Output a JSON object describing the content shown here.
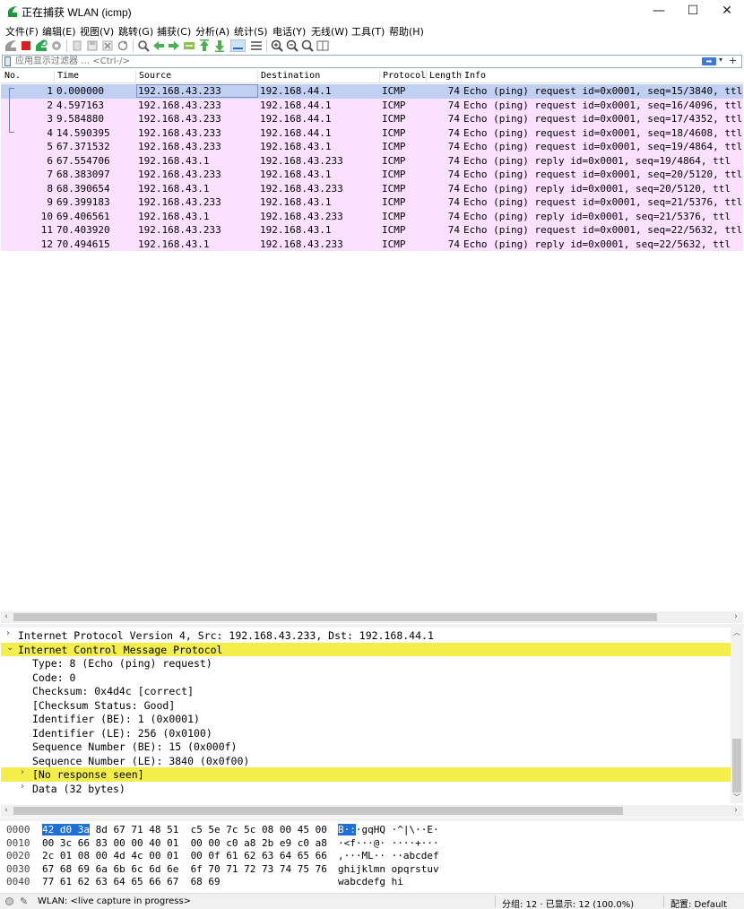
{
  "window": {
    "title": "正在捕获 WLAN (icmp)",
    "minimize_glyph": "—",
    "maximize_glyph": "☐",
    "close_glyph": "✕"
  },
  "menu": [
    "文件(F)",
    "编辑(E)",
    "视图(V)",
    "跳转(G)",
    "捕获(C)",
    "分析(A)",
    "统计(S)",
    "电话(Y)",
    "无线(W)",
    "工具(T)",
    "帮助(H)"
  ],
  "toolbar": {
    "icons": [
      "shark-fin-start-icon",
      "stop-capture-icon",
      "restart-capture-icon",
      "capture-options-icon",
      "open-file-icon",
      "save-file-icon",
      "close-file-icon",
      "reload-file-icon",
      "find-packet-icon",
      "go-back-icon",
      "go-forward-icon",
      "go-to-packet-icon",
      "go-first-icon",
      "go-last-icon",
      "auto-scroll-icon",
      "colorize-icon",
      "zoom-in-icon",
      "zoom-out-icon",
      "zoom-normal-icon",
      "resize-columns-icon"
    ]
  },
  "filter": {
    "placeholder": "应用显示过滤器 … <Ctrl-/>",
    "apply_glyph": "➡",
    "dropdown_glyph": "▾",
    "add_glyph": "+"
  },
  "packet_list": {
    "columns": [
      "No.",
      "Time",
      "Source",
      "Destination",
      "Protocol",
      "Length",
      "Info"
    ],
    "rows": [
      {
        "no": "1",
        "time": "0.000000",
        "src": "192.168.43.233",
        "dst": "192.168.44.1",
        "proto": "ICMP",
        "len": "74",
        "info": "Echo (ping) request  id=0x0001, seq=15/3840, ttl"
      },
      {
        "no": "2",
        "time": "4.597163",
        "src": "192.168.43.233",
        "dst": "192.168.44.1",
        "proto": "ICMP",
        "len": "74",
        "info": "Echo (ping) request  id=0x0001, seq=16/4096, ttl"
      },
      {
        "no": "3",
        "time": "9.584880",
        "src": "192.168.43.233",
        "dst": "192.168.44.1",
        "proto": "ICMP",
        "len": "74",
        "info": "Echo (ping) request  id=0x0001, seq=17/4352, ttl"
      },
      {
        "no": "4",
        "time": "14.590395",
        "src": "192.168.43.233",
        "dst": "192.168.44.1",
        "proto": "ICMP",
        "len": "74",
        "info": "Echo (ping) request  id=0x0001, seq=18/4608, ttl"
      },
      {
        "no": "5",
        "time": "67.371532",
        "src": "192.168.43.233",
        "dst": "192.168.43.1",
        "proto": "ICMP",
        "len": "74",
        "info": "Echo (ping) request  id=0x0001, seq=19/4864, ttl"
      },
      {
        "no": "6",
        "time": "67.554706",
        "src": "192.168.43.1",
        "dst": "192.168.43.233",
        "proto": "ICMP",
        "len": "74",
        "info": "Echo (ping) reply    id=0x0001, seq=19/4864, ttl"
      },
      {
        "no": "7",
        "time": "68.383097",
        "src": "192.168.43.233",
        "dst": "192.168.43.1",
        "proto": "ICMP",
        "len": "74",
        "info": "Echo (ping) request  id=0x0001, seq=20/5120, ttl"
      },
      {
        "no": "8",
        "time": "68.390654",
        "src": "192.168.43.1",
        "dst": "192.168.43.233",
        "proto": "ICMP",
        "len": "74",
        "info": "Echo (ping) reply    id=0x0001, seq=20/5120, ttl"
      },
      {
        "no": "9",
        "time": "69.399183",
        "src": "192.168.43.233",
        "dst": "192.168.43.1",
        "proto": "ICMP",
        "len": "74",
        "info": "Echo (ping) request  id=0x0001, seq=21/5376, ttl"
      },
      {
        "no": "10",
        "time": "69.406561",
        "src": "192.168.43.1",
        "dst": "192.168.43.233",
        "proto": "ICMP",
        "len": "74",
        "info": "Echo (ping) reply    id=0x0001, seq=21/5376, ttl"
      },
      {
        "no": "11",
        "time": "70.403920",
        "src": "192.168.43.233",
        "dst": "192.168.43.1",
        "proto": "ICMP",
        "len": "74",
        "info": "Echo (ping) request  id=0x0001, seq=22/5632, ttl"
      },
      {
        "no": "12",
        "time": "70.494615",
        "src": "192.168.43.1",
        "dst": "192.168.43.233",
        "proto": "ICMP",
        "len": "74",
        "info": "Echo (ping) reply    id=0x0001, seq=22/5632, ttl"
      }
    ],
    "selected_row": "1"
  },
  "details": [
    {
      "arrow": "›",
      "text": "Internet Protocol Version 4, Src: 192.168.43.233, Dst: 192.168.44.1",
      "level": 0,
      "hl": false
    },
    {
      "arrow": "⌄",
      "text": "Internet Control Message Protocol",
      "level": 0,
      "hl": true
    },
    {
      "arrow": "",
      "text": "Type: 8 (Echo (ping) request)",
      "level": 1,
      "hl": false
    },
    {
      "arrow": "",
      "text": "Code: 0",
      "level": 1,
      "hl": false
    },
    {
      "arrow": "",
      "text": "Checksum: 0x4d4c [correct]",
      "level": 1,
      "hl": false
    },
    {
      "arrow": "",
      "text": "[Checksum Status: Good]",
      "level": 1,
      "hl": false
    },
    {
      "arrow": "",
      "text": "Identifier (BE): 1 (0x0001)",
      "level": 1,
      "hl": false
    },
    {
      "arrow": "",
      "text": "Identifier (LE): 256 (0x0100)",
      "level": 1,
      "hl": false
    },
    {
      "arrow": "",
      "text": "Sequence Number (BE): 15 (0x000f)",
      "level": 1,
      "hl": false
    },
    {
      "arrow": "",
      "text": "Sequence Number (LE): 3840 (0x0f00)",
      "level": 1,
      "hl": false
    },
    {
      "arrow": "›",
      "text": "[No response seen]",
      "level": 1,
      "hl": true
    },
    {
      "arrow": "›",
      "text": "Data (32 bytes)",
      "level": 1,
      "hl": false
    }
  ],
  "bytes": [
    {
      "offset": "0000",
      "hex_sel": "42 d0 3a",
      "hex_rest": " 8d 67 71 48 51  c5 5e 7c 5c 08 00 45 00",
      "asc_sel": "B·:",
      "asc_rest": "·gqHQ ·^|\\··E·"
    },
    {
      "offset": "0010",
      "hex_sel": "",
      "hex_rest": "00 3c 66 83 00 00 40 01  00 00 c0 a8 2b e9 c0 a8",
      "asc_sel": "",
      "asc_rest": "·<f···@· ····+···"
    },
    {
      "offset": "0020",
      "hex_sel": "",
      "hex_rest": "2c 01 08 00 4d 4c 00 01  00 0f 61 62 63 64 65 66",
      "asc_sel": "",
      "asc_rest": ",···ML·· ··abcdef"
    },
    {
      "offset": "0030",
      "hex_sel": "",
      "hex_rest": "67 68 69 6a 6b 6c 6d 6e  6f 70 71 72 73 74 75 76",
      "asc_sel": "",
      "asc_rest": "ghijklmn opqrstuv"
    },
    {
      "offset": "0040",
      "hex_sel": "",
      "hex_rest": "77 61 62 63 64 65 66 67  68 69",
      "asc_sel": "",
      "asc_rest": "wabcdefg hi"
    }
  ],
  "status": {
    "interface": "WLAN: <live capture in progress>",
    "packets": "分组: 12 · 已显示: 12 (100.0%)",
    "profile": "配置: Default"
  },
  "colors": {
    "row_bg": "#fce0ff",
    "selected_row_bg": "#c0cff2",
    "highlight_yellow": "#f4ee4a",
    "byte_selection": "#1e6fd8"
  }
}
